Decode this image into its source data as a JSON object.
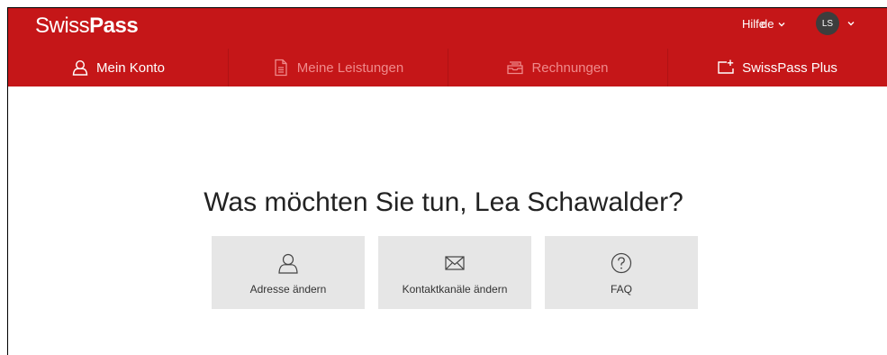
{
  "header": {
    "logo_light": "Swiss",
    "logo_bold": "Pass",
    "help_label": "Hilfe",
    "language": "de",
    "avatar_initials": "LS",
    "brand_color": "#c51618"
  },
  "nav": {
    "items": [
      {
        "label": "Mein Konto",
        "icon": "user-icon",
        "active": true
      },
      {
        "label": "Meine Leistungen",
        "icon": "document-icon",
        "active": false
      },
      {
        "label": "Rechnungen",
        "icon": "invoice-tray-icon",
        "active": false
      },
      {
        "label": "SwissPass Plus",
        "icon": "add-card-icon",
        "active": true
      }
    ]
  },
  "main": {
    "title": "Was möchten Sie tun, Lea Schawalder?",
    "cards": [
      {
        "label": "Adresse ändern",
        "icon": "user-icon"
      },
      {
        "label": "Kontaktkanäle ändern",
        "icon": "envelope-icon"
      },
      {
        "label": "FAQ",
        "icon": "question-circle-icon"
      }
    ]
  }
}
